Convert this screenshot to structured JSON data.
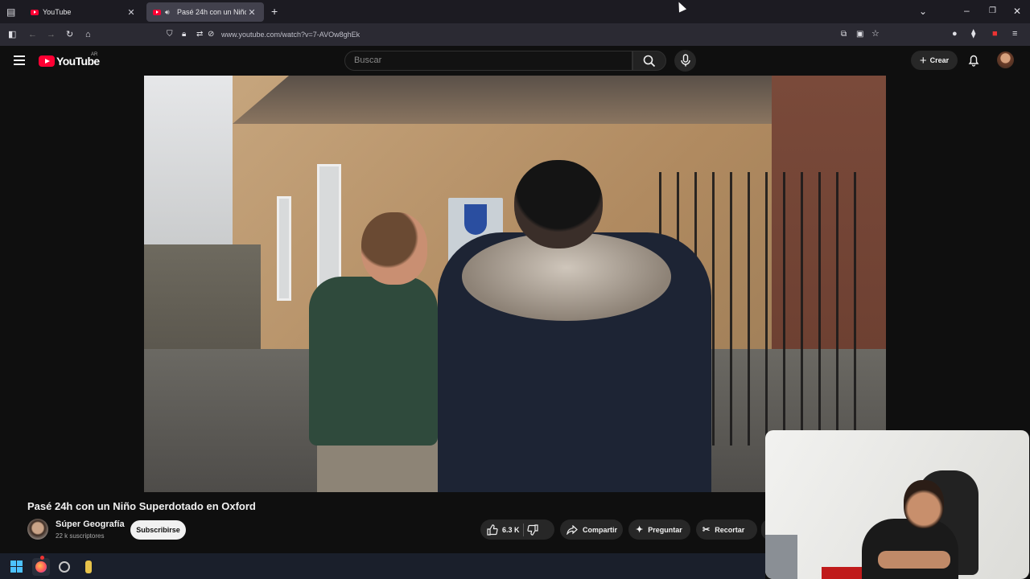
{
  "browser": {
    "tabs": [
      {
        "title": "YouTube",
        "active": false
      },
      {
        "title": "Pasé 24h con un Niño Superdotado en Oxford",
        "active": true
      }
    ],
    "new_tab_icon": "plus-icon",
    "url": "www.youtube.com/watch?v=7-AVOw8ghEk",
    "window_controls": [
      "minimize-icon",
      "restore-icon",
      "close-icon"
    ],
    "extensions_badge": "20"
  },
  "youtube": {
    "logo_text": "YouTube",
    "country_code": "AR",
    "search_placeholder": "Buscar",
    "create_label": "Crear",
    "video": {
      "title": "Pasé 24h con un Niño Superdotado en Oxford",
      "channel_name": "Súper Geografía",
      "subscribers": "22 k suscriptores",
      "subscribe_label": "Subscribirse",
      "likes": "6.3 K",
      "share_label": "Compartir",
      "ask_label": "Preguntar",
      "clip_label": "Recortar"
    }
  },
  "colors": {
    "youtube_red": "#ff0033",
    "background": "#0f0f0f",
    "pill": "#272727",
    "browser_tabstrip": "#1c1b22",
    "browser_toolbar": "#2b2a33"
  }
}
